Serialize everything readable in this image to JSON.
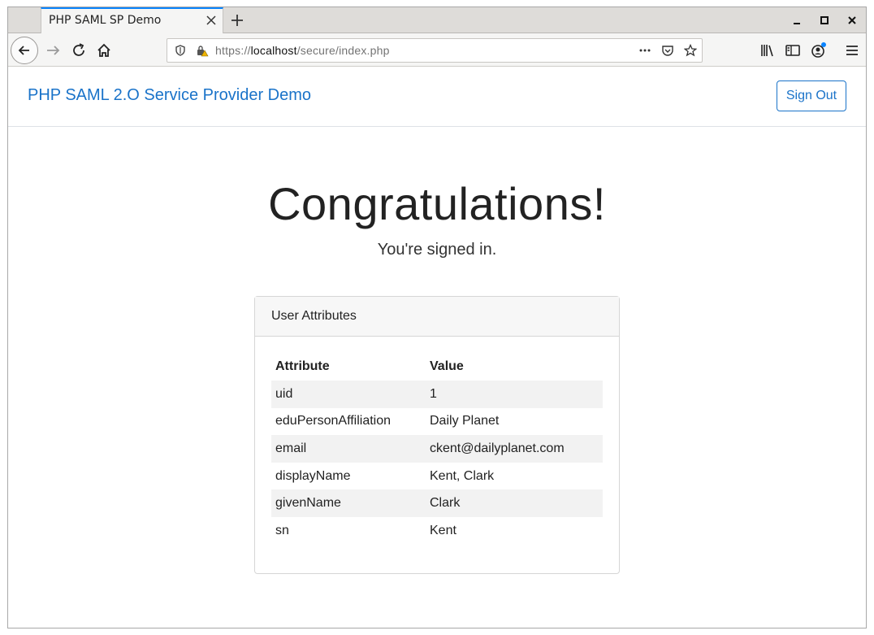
{
  "browser": {
    "tab_title": "PHP SAML SP Demo",
    "url_prefix": "https://",
    "url_host": "localhost",
    "url_path": "/secure/index.php"
  },
  "header": {
    "brand": "PHP SAML 2.O Service Provider Demo",
    "signout_label": "Sign Out"
  },
  "hero": {
    "title": "Congratulations!",
    "subtitle": "You're signed in."
  },
  "attributes": {
    "card_title": "User Attributes",
    "col_attribute": "Attribute",
    "col_value": "Value",
    "rows": [
      {
        "name": "uid",
        "value": "1"
      },
      {
        "name": "eduPersonAffiliation",
        "value": "Daily Planet"
      },
      {
        "name": "email",
        "value": "ckent@dailyplanet.com"
      },
      {
        "name": "displayName",
        "value": "Kent, Clark"
      },
      {
        "name": "givenName",
        "value": "Clark"
      },
      {
        "name": "sn",
        "value": "Kent"
      }
    ]
  },
  "colors": {
    "accent": "#1a73c9",
    "tab_highlight": "#0a84ff"
  }
}
